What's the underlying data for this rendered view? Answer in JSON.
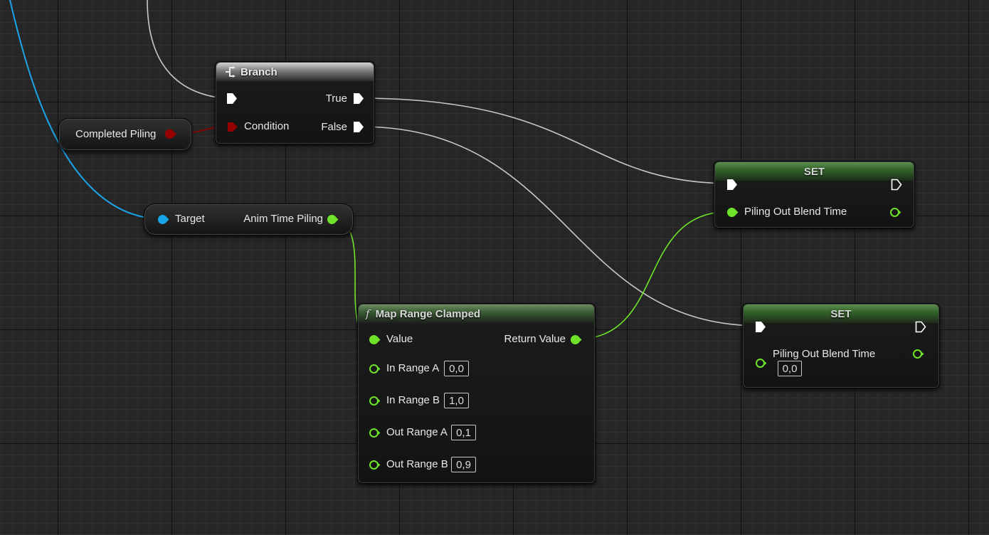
{
  "nodes": {
    "branch": {
      "title": "Branch",
      "true_label": "True",
      "false_label": "False",
      "condition_label": "Condition"
    },
    "completed_piling": {
      "label": "Completed Piling"
    },
    "anim_time_getter": {
      "target_label": "Target",
      "output_label": "Anim Time Piling"
    },
    "set_top": {
      "title": "SET",
      "var_label": "Piling Out Blend Time"
    },
    "set_bottom": {
      "title": "SET",
      "var_label": "Piling Out Blend Time",
      "value": "0,0"
    },
    "map_range": {
      "title": "Map Range Clamped",
      "func_symbol": "f",
      "value_label": "Value",
      "return_label": "Return Value",
      "pins": [
        {
          "label": "In Range A",
          "value": "0,0"
        },
        {
          "label": "In Range B",
          "value": "1,0"
        },
        {
          "label": "Out Range A",
          "value": "0,1"
        },
        {
          "label": "Out Range B",
          "value": "0,9"
        }
      ]
    }
  },
  "colors": {
    "exec_wire": "#c8c8c8",
    "float_wire": "#6fe32a",
    "bool_wire": "#950000",
    "object_wire": "#1aa5e8",
    "float_pin": "#6fe32a",
    "bool_pin": "#950000",
    "object_pin": "#1aa5e8"
  }
}
